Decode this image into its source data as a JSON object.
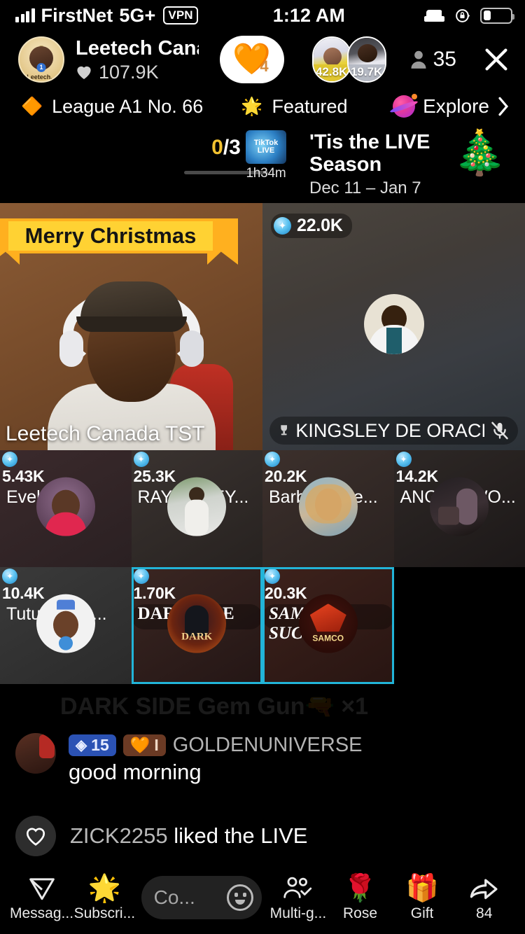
{
  "statusbar": {
    "carrier": "FirstNet",
    "network": "5G+",
    "vpn": "VPN",
    "time": "1:12 AM",
    "icons": [
      "signal-icon",
      "bed-icon",
      "rotation-lock-icon",
      "battery-icon"
    ]
  },
  "header": {
    "host": {
      "name": "Leetech Canada...",
      "avatar_label": "Leetech...",
      "avatar_level": "1",
      "likes": "107.9K",
      "heart_icon": "heart-icon"
    },
    "like_button": {
      "icon": "heart-icon",
      "count": "4"
    },
    "cohosts": [
      {
        "name": "cohost-1",
        "coins": "42.8K"
      },
      {
        "name": "cohost-2",
        "coins": "19.7K"
      }
    ],
    "viewers": {
      "icon": "person-icon",
      "count": "35"
    },
    "close_icon": "close-icon"
  },
  "subheader": {
    "league": {
      "icon": "gem-icon",
      "label": "League A1 No. 66"
    },
    "featured": {
      "icon": "featured-star-icon",
      "label": "Featured"
    },
    "explore": {
      "icon": "planet-icon",
      "label": "Explore",
      "chevron": "chevron-right-icon"
    }
  },
  "event": {
    "progress": "0/3",
    "progress_done": "0",
    "progress_total": "/3",
    "logo_text": "TikTok LIVE",
    "duration": "1h34m",
    "title": "'Tis the LIVE Season",
    "dates": "Dec 11 – Jan 7",
    "decor_icon": "christmas-tree-icon"
  },
  "grid": {
    "main": [
      {
        "name": "Leetech Canada TST",
        "overlay_text": "Merry Christmas",
        "gems": null,
        "muted": false,
        "selected": false
      },
      {
        "name": "KINGSLEY DE ORACLE🇺🇸 🇳🇬",
        "gems": "22.0K",
        "muted": true,
        "selected": false,
        "trophy_icon": "trophy-icon"
      }
    ],
    "small": [
      {
        "name": "Evelyn",
        "gems": "5.43K",
        "muted": true,
        "selected": false
      },
      {
        "name": "RAYMONEY...",
        "gems": "25.3K",
        "muted": true,
        "selected": false
      },
      {
        "name": "Barbie Lope...",
        "gems": "20.2K",
        "muted": true,
        "selected": false
      },
      {
        "name": "ANGELSWO...",
        "gems": "14.2K",
        "muted": true,
        "selected": false
      },
      {
        "name": "Tutunalove...",
        "gems": "10.4K",
        "muted": true,
        "selected": false
      },
      {
        "name": "DARK SIDE",
        "gems": "1.70K",
        "muted": false,
        "selected": true
      },
      {
        "name": "SAMCO SUCC...",
        "gems": "20.3K",
        "muted": false,
        "selected": true
      }
    ]
  },
  "chat": {
    "faded_gift": "DARK SIDE Gem Gun🔫 ×1",
    "messages": [
      {
        "level_badge": "15",
        "level_icon": "diamond-icon",
        "fan_badge": "I",
        "fan_icon": "heart-icon",
        "user": "GOLDENUNIVERSE",
        "text": "good morning"
      }
    ],
    "like_event": {
      "icon": "heart-outline-icon",
      "user": "ZICK2255",
      "text": "liked the LIVE"
    }
  },
  "bottombar": {
    "items": [
      {
        "icon": "send-message-icon",
        "label": "Messag..."
      },
      {
        "icon": "subscribe-star-icon",
        "label": "Subscri..."
      }
    ],
    "comment_input": {
      "placeholder": "Co...",
      "emoji_icon": "smiley-icon"
    },
    "right_items": [
      {
        "icon": "multi-guest-icon",
        "label": "Multi-g..."
      },
      {
        "icon": "rose-icon",
        "label": "Rose"
      },
      {
        "icon": "gift-icon",
        "label": "Gift"
      },
      {
        "icon": "share-icon",
        "label": "84"
      }
    ]
  },
  "colors": {
    "accent_selected": "#22b4d8",
    "gold": "#f2c230",
    "gem_blue": "#5bc2f0",
    "background": "#000000"
  }
}
